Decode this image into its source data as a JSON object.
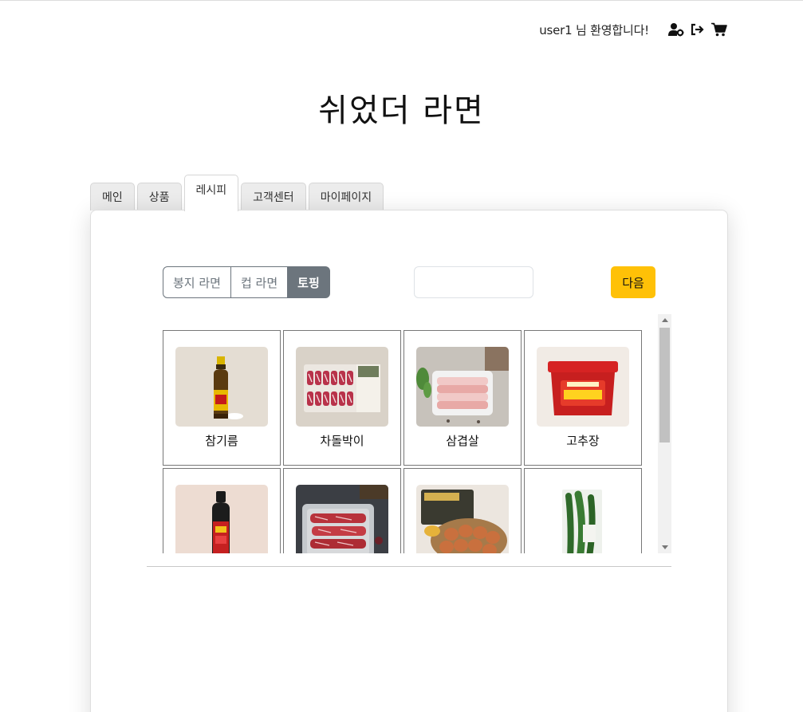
{
  "header": {
    "welcome_text": "user1 님 환영합니다!",
    "icons": [
      "user-settings-icon",
      "logout-icon",
      "cart-icon"
    ]
  },
  "site": {
    "title": "쉬었더 라면"
  },
  "tabs": [
    {
      "label": "메인",
      "active": false
    },
    {
      "label": "상품",
      "active": false
    },
    {
      "label": "레시피",
      "active": true
    },
    {
      "label": "고객센터",
      "active": false
    },
    {
      "label": "마이페이지",
      "active": false
    }
  ],
  "filter": {
    "options": [
      {
        "label": "봉지 라면",
        "active": false
      },
      {
        "label": "컵 라면",
        "active": false
      },
      {
        "label": "토핑",
        "active": true
      }
    ]
  },
  "search": {
    "value": "",
    "placeholder": ""
  },
  "next_button": {
    "label": "다음"
  },
  "products": [
    {
      "name": "참기름",
      "image": "sesame-oil-bottle"
    },
    {
      "name": "차돌박이",
      "image": "brisket-package"
    },
    {
      "name": "삼겹살",
      "image": "pork-belly-tray"
    },
    {
      "name": "고추장",
      "image": "gochujang-tub"
    },
    {
      "name": "",
      "image": "hot-sauce-bottle"
    },
    {
      "name": "",
      "image": "beef-tray"
    },
    {
      "name": "",
      "image": "eggs-basket"
    },
    {
      "name": "",
      "image": "green-peppers-bag"
    }
  ],
  "colors": {
    "accent": "#ffc107",
    "segment_active": "#6c757d",
    "tab_inactive_bg": "#ececec"
  }
}
